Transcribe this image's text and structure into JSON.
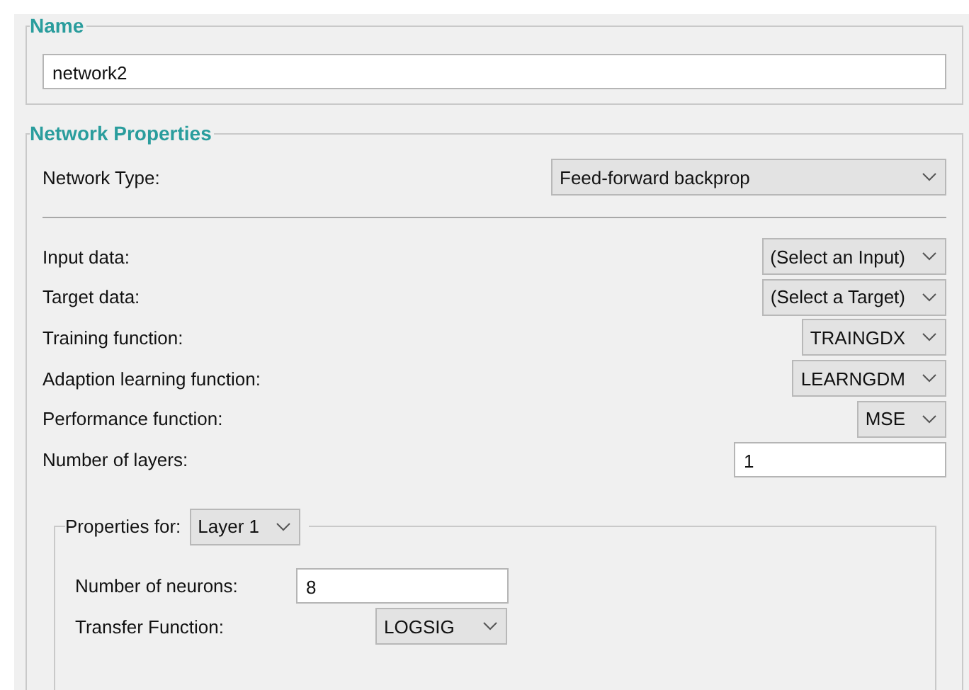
{
  "name_group": {
    "legend": "Name",
    "value": "network2"
  },
  "network_properties": {
    "legend": "Network Properties",
    "network_type": {
      "label": "Network Type:",
      "value": "Feed-forward backprop"
    },
    "fields": [
      {
        "kind": "dropdown",
        "label": "Input data:",
        "value": "(Select an Input)"
      },
      {
        "kind": "dropdown",
        "label": "Target data:",
        "value": "(Select a Target)"
      },
      {
        "kind": "dropdown",
        "label": "Training function:",
        "value": "TRAINGDX"
      },
      {
        "kind": "dropdown",
        "label": "Adaption learning function:",
        "value": "LEARNGDM"
      },
      {
        "kind": "dropdown",
        "label": "Performance function:",
        "value": "MSE"
      },
      {
        "kind": "input",
        "label": "Number of layers:",
        "value": "1"
      }
    ],
    "layer_properties": {
      "label": "Properties for:",
      "layer": "Layer 1",
      "fields": [
        {
          "kind": "input",
          "label": "Number of neurons:",
          "value": "8"
        },
        {
          "kind": "dropdown",
          "label": "Transfer Function:",
          "value": "LOGSIG"
        }
      ]
    }
  }
}
